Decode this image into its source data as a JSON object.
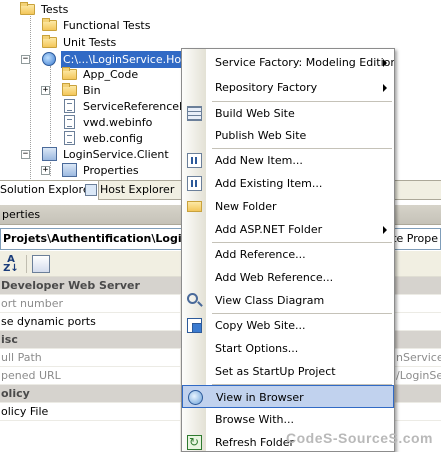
{
  "tree": {
    "items": [
      {
        "label": "Tests"
      },
      {
        "label": "Functional Tests"
      },
      {
        "label": "Unit Tests"
      },
      {
        "label": "C:\\...\\LoginService.Host\\"
      },
      {
        "label": "App_Code"
      },
      {
        "label": "Bin"
      },
      {
        "label": "ServiceReferenceLog"
      },
      {
        "label": "vwd.webinfo"
      },
      {
        "label": "web.config"
      },
      {
        "label": "LoginService.Client"
      },
      {
        "label": "Properties"
      }
    ]
  },
  "tabs": [
    {
      "label": "Solution Explorer"
    },
    {
      "label": "Host Explorer"
    }
  ],
  "properties": {
    "title": "perties",
    "object": "Projets\\Authentification\\LoginSe",
    "object_right": "Site Prope",
    "rows": [
      {
        "name": "Developer Web Server",
        "value": ""
      },
      {
        "name": "ort number",
        "value": ""
      },
      {
        "name": "se dynamic ports",
        "value": ""
      },
      {
        "name": "isc",
        "value": ""
      },
      {
        "name": "ull Path",
        "value": "nService\\"
      },
      {
        "name": "pened URL",
        "value": "/LoginSe"
      },
      {
        "name": "olicy",
        "value": ""
      },
      {
        "name": "olicy File",
        "value": ""
      }
    ]
  },
  "menu": {
    "items": [
      {
        "label": "Service Factory: Modeling Edition"
      },
      {
        "label": "Repository Factory"
      },
      {
        "label": "Build Web Site"
      },
      {
        "label": "Publish Web Site"
      },
      {
        "label": "Add New Item..."
      },
      {
        "label": "Add Existing Item..."
      },
      {
        "label": "New Folder"
      },
      {
        "label": "Add ASP.NET Folder"
      },
      {
        "label": "Add Reference..."
      },
      {
        "label": "Add Web Reference..."
      },
      {
        "label": "View Class Diagram"
      },
      {
        "label": "Copy Web Site..."
      },
      {
        "label": "Start Options..."
      },
      {
        "label": "Set as StartUp Project"
      },
      {
        "label": "View in Browser"
      },
      {
        "label": "Browse With..."
      },
      {
        "label": "Refresh Folder"
      }
    ]
  },
  "watermark": "CodeS-SourceS.com"
}
